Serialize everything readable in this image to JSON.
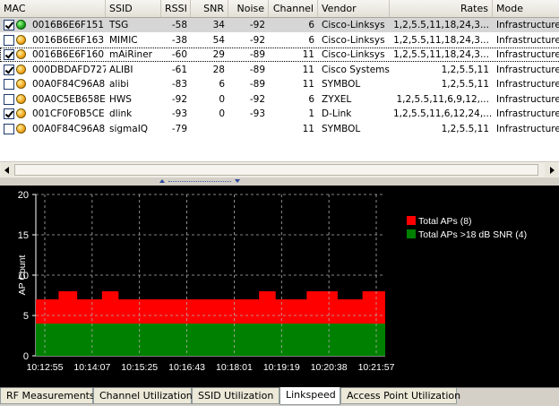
{
  "table": {
    "columns": [
      "MAC",
      "SSID",
      "RSSI",
      "SNR",
      "Noise",
      "Channel",
      "Vendor",
      "Rates",
      "Mode"
    ],
    "rows": [
      {
        "checked": true,
        "status": "green",
        "mac": "0016B6E6F151",
        "ssid": "TSG",
        "rssi": "-58",
        "snr": "34",
        "noise": "-92",
        "channel": "6",
        "vendor": "Cisco-Linksys",
        "rates": "1,2,5.5,11,18,24,3...",
        "mode": "Infrastructure"
      },
      {
        "checked": false,
        "status": "orange",
        "mac": "0016B6E6F163",
        "ssid": "MIMIC",
        "rssi": "-38",
        "snr": "54",
        "noise": "-92",
        "channel": "6",
        "vendor": "Cisco-Linksys",
        "rates": "1,2,5.5,11,18,24,3...",
        "mode": "Infrastructure"
      },
      {
        "checked": true,
        "status": "orange",
        "mac": "0016B6E6F160",
        "ssid": "mAiRiner",
        "rssi": "-60",
        "snr": "29",
        "noise": "-89",
        "channel": "11",
        "vendor": "Cisco-Linksys",
        "rates": "1,2,5.5,11,18,24,3...",
        "mode": "Infrastructure"
      },
      {
        "checked": true,
        "status": "orange",
        "mac": "000DBDAFD727",
        "ssid": "ALIBI",
        "rssi": "-61",
        "snr": "28",
        "noise": "-89",
        "channel": "11",
        "vendor": "Cisco Systems",
        "rates": "1,2,5.5,11",
        "mode": "Infrastructure"
      },
      {
        "checked": false,
        "status": "orange",
        "mac": "00A0F84C96A8",
        "ssid": "alibi",
        "rssi": "-83",
        "snr": "6",
        "noise": "-89",
        "channel": "11",
        "vendor": "SYMBOL",
        "rates": "1,2,5.5,11",
        "mode": "Infrastructure"
      },
      {
        "checked": false,
        "status": "orange",
        "mac": "00A0C5EB658E",
        "ssid": "HWS",
        "rssi": "-92",
        "snr": "0",
        "noise": "-92",
        "channel": "6",
        "vendor": "ZYXEL",
        "rates": "1,2,5.5,11,6,9,12,...",
        "mode": "Infrastructure"
      },
      {
        "checked": true,
        "status": "orange",
        "mac": "001CF0F0B5CE",
        "ssid": "dlink",
        "rssi": "-93",
        "snr": "0",
        "noise": "-93",
        "channel": "1",
        "vendor": "D-Link",
        "rates": "1,2,5.5,11,6,12,24,...",
        "mode": "Infrastructure"
      },
      {
        "checked": false,
        "status": "orange",
        "mac": "00A0F84C96A8",
        "ssid": "sigmaIQ",
        "rssi": "-79",
        "snr": "",
        "noise": "",
        "channel": "11",
        "vendor": "SYMBOL",
        "rates": "1,2,5.5,11",
        "mode": "Infrastructure"
      }
    ]
  },
  "chart_data": {
    "type": "area",
    "ylabel": "AP Count",
    "ylim": [
      0,
      20
    ],
    "yticks": [
      0,
      5,
      10,
      15,
      20
    ],
    "xticks": [
      "10:12:55",
      "10:14:07",
      "10:15:25",
      "10:16:43",
      "10:18:01",
      "10:19:19",
      "10:20:38",
      "10:21:57"
    ],
    "grid": true,
    "legend_position": "top-right",
    "background": "#000000",
    "series": [
      {
        "name": "Total APs (8)",
        "color": "#ff0000",
        "values": [
          7,
          7,
          7,
          7,
          7,
          7,
          7,
          7,
          7,
          7,
          7,
          8,
          8,
          8,
          8,
          8,
          8,
          8,
          8,
          8,
          7,
          7,
          7,
          7,
          7,
          7,
          7,
          7,
          7,
          7,
          7,
          7,
          8,
          8,
          8,
          8,
          8,
          8,
          8,
          8,
          7,
          7,
          7,
          7,
          7,
          7,
          7,
          7,
          7,
          7,
          7,
          7,
          7,
          7,
          7,
          7,
          7,
          7,
          7,
          7,
          7,
          7,
          7,
          7,
          7,
          7,
          7,
          7,
          7,
          7,
          7,
          7,
          7,
          7,
          7,
          7,
          7,
          7,
          7,
          7,
          7,
          7,
          7,
          7,
          7,
          7,
          7,
          7,
          7,
          7,
          7,
          7,
          7,
          7,
          7,
          7,
          7,
          7,
          7,
          7,
          7,
          7,
          7,
          7,
          7,
          7,
          7,
          7,
          8,
          8,
          8,
          8,
          8,
          8,
          8,
          8,
          7,
          7,
          7,
          7,
          7,
          7,
          7,
          7,
          7,
          7,
          7,
          7,
          7,
          7,
          7,
          8,
          8,
          8,
          8,
          8,
          8,
          8,
          8,
          8,
          8,
          8,
          8,
          8,
          8,
          8,
          7,
          7,
          7,
          7,
          7,
          7,
          7,
          7,
          7,
          7,
          7,
          7,
          8,
          8,
          8,
          8,
          8,
          8,
          8,
          8,
          8,
          8,
          8,
          8
        ]
      },
      {
        "name": "Total APs >18 dB SNR (4)",
        "color": "#008000",
        "values": [
          4,
          4,
          4,
          4,
          4,
          4,
          4,
          4,
          4,
          4,
          4,
          4,
          4,
          4,
          4,
          4,
          4,
          4,
          4,
          4,
          4,
          4,
          4,
          4,
          4,
          4,
          4,
          4,
          4,
          4,
          4,
          4,
          4,
          4,
          4,
          4,
          4,
          4,
          4,
          4,
          4,
          4,
          4,
          4,
          4,
          4,
          4,
          4,
          4,
          4,
          4,
          4,
          4,
          4,
          4,
          4,
          4,
          4,
          4,
          4,
          4,
          4,
          4,
          4,
          4,
          4,
          4,
          4,
          4,
          4,
          4,
          4,
          4,
          4,
          4,
          4,
          4,
          4,
          4,
          4,
          4,
          4,
          4,
          4,
          4,
          4,
          4,
          4,
          4,
          4,
          4,
          4,
          4,
          4,
          4,
          4,
          4,
          4,
          4,
          4,
          4,
          4,
          4,
          4,
          4,
          4,
          4,
          4,
          4,
          4,
          4,
          4,
          4,
          4,
          4,
          4,
          4,
          4,
          4,
          4,
          4,
          4,
          4,
          4,
          4,
          4,
          4,
          4,
          4,
          4,
          4,
          4,
          4,
          4,
          4,
          4,
          4,
          4,
          4,
          4,
          4,
          4,
          4,
          4,
          4,
          4,
          4,
          4,
          4,
          4,
          4,
          4,
          4,
          4,
          4,
          4,
          4,
          4,
          4,
          4,
          4,
          4,
          4,
          4,
          4,
          4,
          4,
          4,
          4,
          4
        ]
      }
    ]
  },
  "tabs": [
    "RF Measurements",
    "Channel Utilization",
    "SSID Utilization",
    "Linkspeed",
    "Access Point Utilization"
  ],
  "active_tab": "Linkspeed"
}
